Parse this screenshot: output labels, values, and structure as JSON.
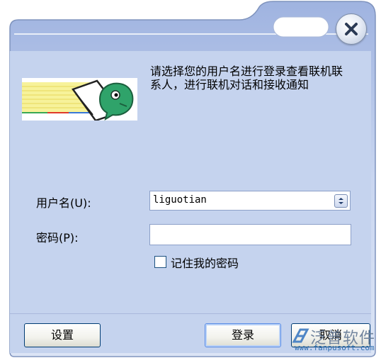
{
  "dialog": {
    "message": "请选择您的用户名进行登录查看联机联系人，进行联机对话和接收通知"
  },
  "form": {
    "username_label": "用户名(U):",
    "username_value": "liguotian",
    "password_label": "密码(P):",
    "password_value": "",
    "remember_label": "记住我的密码",
    "remember_checked": false
  },
  "buttons": {
    "settings": "设置",
    "login": "登录",
    "cancel": "取消"
  },
  "watermark": {
    "name": "泛普软件",
    "url": "www.fanpusoft.com"
  },
  "icons": {
    "close": "close-icon",
    "banner": "messenger-logo-icon",
    "dropdown": "dropdown-arrow-icon",
    "watermark": "fanpu-logo-icon"
  },
  "colors": {
    "dialog_background": "#c5d3ee",
    "button_border": "#003c74",
    "default_button_highlight": "#5a8de6"
  }
}
